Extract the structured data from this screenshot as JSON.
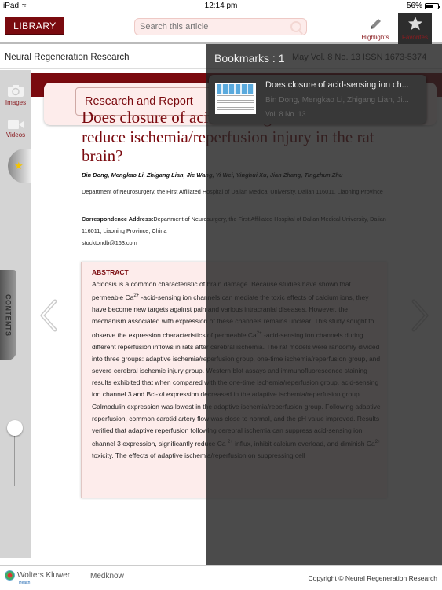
{
  "status_bar": {
    "device": "iPad",
    "time": "12:14 pm",
    "battery": "56%",
    "battery_level": 0.56
  },
  "toolbar": {
    "library_label": "LIBRARY",
    "search_placeholder": "Search this article",
    "highlights_label": "Highlights",
    "favorites_label": "Favorites"
  },
  "header": {
    "journal": "Neural Regeneration Research",
    "issue_meta": "May   Vol. 8 No. 13    ISSN 1673-5374"
  },
  "sidebar": {
    "images_label": "Images",
    "videos_label": "Videos",
    "contents_label": "CONTENTS",
    "zoom_level": 0.0
  },
  "article": {
    "section": "Research and Report",
    "title": "Does closure of acid-sensing ion channels reduce ischemia/reperfusion injury in the rat brain?",
    "authors": "Bin Dong, Mengkao Li, Zhigang Lian, Jie Wang, Yi Wei, Yinghui Xu, Jian Zhang, Tingzhun Zhu",
    "department": "Department of Neurosurgery, the First Affiliated Hospital of Dalian Medical University, Dalian 116011, Liaoning Province",
    "correspondence_label": "Correspondence Address:",
    "correspondence": "Department of Neurosurgery, the First Affiliated Hospital of Dalian Medical University, Dalian 116011, Liaoning Province, China",
    "email": "stocktondb@163.com",
    "abstract_heading": "ABSTRACT",
    "abstract_parts": [
      "Acidosis is a common characteristic of brain damage. Because studies have shown that permeable Ca",
      "2+",
      " -acid-sensing ion channels can mediate the toxic effects of calcium ions, they have become new targets against pain and various intracranial diseases. However, the mechanism associated with expression of these channels remains unclear. This study sought to observe the expression characteristics of permeable Ca",
      "2+",
      " -acid-sensing ion channels during different reperfusion inflows in rats after cerebral ischemia. The rat models were randomly divided into three groups: adaptive ischemia/reperfusion group, one-time ischemia/reperfusion group, and severe cerebral ischemic injury group. Western blot assays and immunofluorescence staining results exhibited that when compared with the one-time ischemia/reperfusion group, acid-sensing ion channel 3 and Bcl-x/l expression decreased in the adaptive ischemia/reperfusion group. Calmodulin expression was lowest in the adaptive ischemia/reperfusion group. Following adaptive reperfusion, common carotid artery flow was close to normal, and the pH value improved. Results verified that adaptive reperfusion following cerebral ischemia can suppress acid-sensing ion channel 3 expression, significantly reduce Ca ",
      "2+",
      " influx, inhibit calcium overload, and diminish Ca",
      "2+",
      " toxicity. The effects of adaptive ischemia/reperfusion on suppressing cell"
    ]
  },
  "bookmarks": {
    "header": "Bookmarks : 1",
    "items": [
      {
        "title": "Does closure of acid-sensing ion ch...",
        "authors": "Bin Dong, Mengkao Li, Zhigang Lian, Ji...",
        "volume": "Vol. 8 No. 13"
      }
    ]
  },
  "footer": {
    "publisher": "Wolters Kluwer",
    "publisher_sub": "Health",
    "imprint": "Medknow",
    "copyright": "Copyright © Neural Regeneration Research"
  },
  "colors": {
    "brand": "#7a0a0f",
    "accent_bg": "#fdeceb"
  }
}
